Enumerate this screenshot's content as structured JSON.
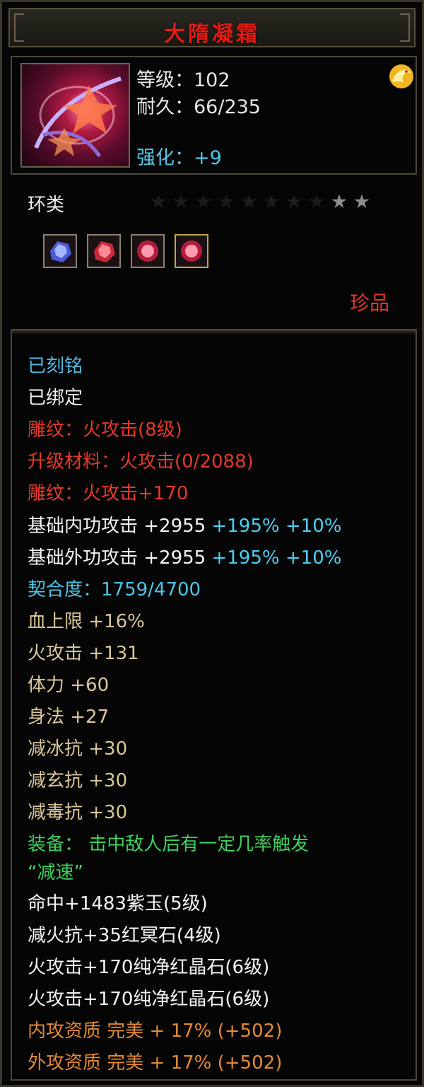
{
  "title": "大隋凝霜",
  "header": {
    "level_label": "等级",
    "level_value": "102",
    "durability_label": "耐久",
    "durability_value": "66/235",
    "enhance_label": "强化",
    "enhance_value": "+9"
  },
  "type_label": "环类",
  "stars": {
    "filled": 2,
    "total": 10
  },
  "gems": [
    "purple-gem-icon",
    "red-gem-icon",
    "red-gem-icon",
    "red-gem-icon"
  ],
  "rarity": "珍品",
  "stats": {
    "engraved": "已刻铭",
    "bound": "已绑定",
    "carving1": "雕纹：火攻击(8级)",
    "upgrade_material": "升级材料：火攻击(0/2088)",
    "carving2": "雕纹：火攻击+170",
    "inner_attack": {
      "label": "基础内功攻击  +2955",
      "bonus1": "+195%",
      "bonus2": "+10%"
    },
    "outer_attack": {
      "label": "基础外功攻击  +2955",
      "bonus1": "+195%",
      "bonus2": "+10%"
    },
    "fit": "契合度：1759/4700",
    "attrs": [
      "血上限 +16%",
      "火攻击 +131",
      "体力 +60",
      "身法 +27",
      "减冰抗 +30",
      "减玄抗 +30",
      "减毒抗 +30"
    ],
    "equip_effect_line1": "装备：  击中敌人后有一定几率触发",
    "equip_effect_line2": "“减速”",
    "gem_lines": [
      "命中+1483紫玉(5级)",
      "减火抗+35红冥石(4级)",
      "火攻击+170纯净红晶石(6级)",
      "火攻击+170纯净红晶石(6级)"
    ],
    "quality_lines": [
      "内攻资质  完美  + 17%  (+502)",
      "外攻资质  完美  + 17%  (+502)"
    ]
  },
  "colors": {
    "title": "#e01c14",
    "engraved": "#56b8e0",
    "carving": "#e23a2a",
    "fit": "#4cc3e6",
    "attr": "#d8c79a",
    "equip": "#3ecf5e",
    "quality": "#e58a34"
  }
}
